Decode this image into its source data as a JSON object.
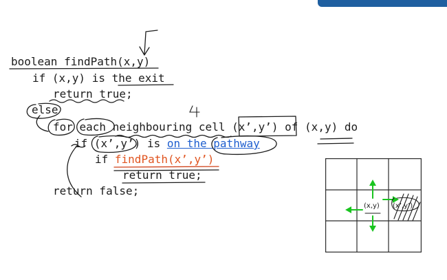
{
  "code": {
    "line1": {
      "t1": "boolean findPath(x,y)"
    },
    "line2": {
      "t1": "if (x,y) is the exit"
    },
    "line3": {
      "t1": "return true;"
    },
    "line4": {
      "t1": "else"
    },
    "line5": {
      "t1": "for each neighbouring cell (x’,y’) of (x,y) do"
    },
    "line6": {
      "t1": "if (x’,y’) is ",
      "t2": "on the pathway"
    },
    "line7": {
      "t1": "if ",
      "t2": "findPath(x’,y’)"
    },
    "line8": {
      "t1": "return true;"
    },
    "line9": {
      "t1": "return false;"
    }
  },
  "grid": {
    "center_label": "(x,y)",
    "neighbour_label": "(x’,y’)",
    "arrow_color": "#19c41f"
  },
  "colors": {
    "recursive_call": "#e0541f",
    "link_text": "#1f5fcf"
  }
}
